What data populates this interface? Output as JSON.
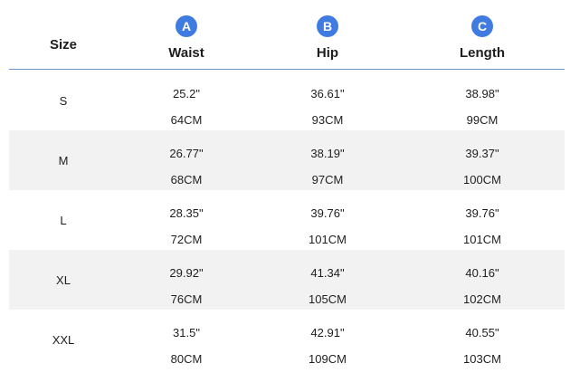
{
  "header": {
    "size_title": "Size",
    "columns": [
      {
        "badge": "A",
        "title": "Waist"
      },
      {
        "badge": "B",
        "title": "Hip"
      },
      {
        "badge": "C",
        "title": "Length"
      }
    ]
  },
  "rows": [
    {
      "size": "S",
      "waist_in": "25.2\"",
      "waist_cm": "64CM",
      "hip_in": "36.61\"",
      "hip_cm": "93CM",
      "length_in": "38.98\"",
      "length_cm": "99CM"
    },
    {
      "size": "M",
      "waist_in": "26.77\"",
      "waist_cm": "68CM",
      "hip_in": "38.19\"",
      "hip_cm": "97CM",
      "length_in": "39.37\"",
      "length_cm": "100CM"
    },
    {
      "size": "L",
      "waist_in": "28.35\"",
      "waist_cm": "72CM",
      "hip_in": "39.76\"",
      "hip_cm": "101CM",
      "length_in": "39.76\"",
      "length_cm": "101CM"
    },
    {
      "size": "XL",
      "waist_in": "29.92\"",
      "waist_cm": "76CM",
      "hip_in": "41.34\"",
      "hip_cm": "105CM",
      "length_in": "40.16\"",
      "length_cm": "102CM"
    },
    {
      "size": "XXL",
      "waist_in": "31.5\"",
      "waist_cm": "80CM",
      "hip_in": "42.91\"",
      "hip_cm": "109CM",
      "length_in": "40.55\"",
      "length_cm": "103CM"
    }
  ],
  "colors": {
    "badge": "#3f7be0",
    "header_line": "#6e8fd0",
    "shaded_row": "#f2f2f2",
    "text": "#1e1e1e"
  }
}
